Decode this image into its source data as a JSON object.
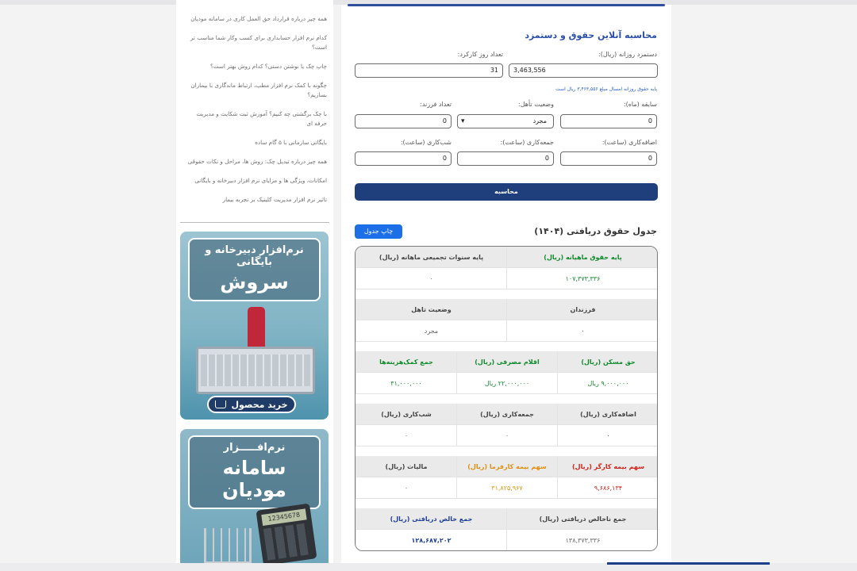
{
  "sidebar": {
    "links": [
      "همه چیز درباره قرارداد حق العمل کاری در سامانه مودیان",
      "کدام نرم افزار حسابداری برای کسب وکار شما مناسب تر است؟",
      "چاپ چک یا نوشتن دستی؟ کدام روش بهتر است؟",
      "چگونه با کمک نرم افزار مطب، ارتباط ماندگاری با بیماران بسازیم؟",
      "با چک برگشتی چه کنیم؟ آموزش ثبت شکایت و مدیریت حرفه ای",
      "بایگانی سازمانی با ۵ گام ساده",
      "همه چیز درباره تبدیل چک: روش ها، مراحل و نکات حقوقی",
      "امکانات، ویژگی ها و مزایای نرم افزار دبیرخانه و بایگانی",
      "تاثیر نرم افزار مدیریت کلینیک بر تجربه بیمار"
    ],
    "banner1": {
      "subtitle": "نرم‌افزار دبیرخانه و بایگانی",
      "title": "سروش",
      "buy_label": "خرید محصول"
    },
    "banner2": {
      "subtitle": "نرم‌افـــــزار",
      "title": "سامانه مودیان",
      "calc_screen": "12345678"
    }
  },
  "calculator": {
    "title": "محاسبه آنلاین حقوق و دستمزد",
    "daily_wage_label": "دستمزد روزانه (ریال):",
    "daily_wage_value": "3,463,556",
    "workdays_label": "تعداد روز کارکرد:",
    "workdays_value": "31",
    "hint": "پایه حقوق روزانه امسال مبلغ ۳,۴۶۳,۵۵۶ ریال است",
    "experience_label": "سابقه (ماه):",
    "experience_value": "0",
    "marital_label": "وضعیت تأهل:",
    "marital_value": "مجرد",
    "children_label": "تعداد فرزند:",
    "children_value": "0",
    "overtime_label": "اضافه‌کاری (ساعت):",
    "overtime_value": "0",
    "friday_label": "جمعه‌کاری (ساعت):",
    "friday_value": "0",
    "night_label": "شب‌کاری (ساعت):",
    "night_value": "0",
    "submit_label": "محاسبه"
  },
  "results": {
    "title": "جدول حقوق دریافتی (۱۴۰۴)",
    "print_label": "چاپ جدول",
    "row1": {
      "h1": "پایه حقوق ماهیانه (ریال)",
      "v1": "۱۰۷,۳۷۳,۳۳۶",
      "h2": "پایه سنوات تجمیعی ماهانه (ریال)",
      "v2": "۰"
    },
    "row2": {
      "h1": "فرزندان",
      "v1": "۰",
      "h2": "وضعیت تاهل",
      "v2": "مجرد"
    },
    "row3": {
      "h1": "حق مسکن (ریال)",
      "v1": "۹,۰۰۰,۰۰۰ ریال",
      "h2": "اقلام مصرفی (ریال)",
      "v2": "۲۲,۰۰۰,۰۰۰ ریال",
      "h3": "جمع کمک‌هزینه‌ها",
      "v3": "۳۱,۰۰۰,۰۰۰"
    },
    "row4": {
      "h1": "اضافه‌کاری (ریال)",
      "v1": "۰",
      "h2": "جمعه‌کاری (ریال)",
      "v2": "۰",
      "h3": "شب‌کاری (ریال)",
      "v3": "۰"
    },
    "row5": {
      "h1": "سهم بیمه کارگر (ریال)",
      "v1": "۹,۶۸۶,۱۳۴",
      "h2": "سهم بیمه کارفرما (ریال)",
      "v2": "۳۱,۸۲۵,۹۶۷",
      "h3": "مالیات (ریال)",
      "v3": "۰"
    },
    "row6": {
      "h1": "جمع ناخالص دریافتی (ریال)",
      "v1": "۱۳۸,۳۷۳,۳۳۶",
      "h2": "جمع خالص دریافتی (ریال)",
      "v2": "۱۲۸,۶۸۷,۲۰۲"
    }
  },
  "colors": {
    "accent": "#1f3f7c",
    "title_blue": "#2b4fa8",
    "print_blue": "#1d6fe8",
    "green": "#0f8a2a",
    "red": "#d0231a",
    "orange": "#e0900f"
  }
}
